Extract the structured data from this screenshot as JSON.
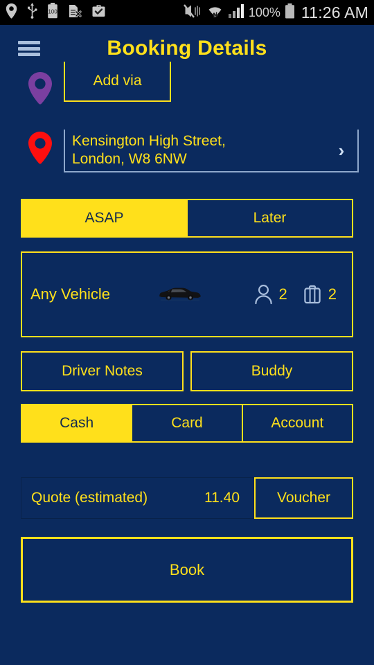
{
  "statusbar": {
    "icons_left": [
      "location-pin-icon",
      "usb-icon",
      "battery-100-icon",
      "sdcard-removed-icon",
      "briefcase-check-icon"
    ],
    "icons_right": [
      "mute-vibrate-icon",
      "wifi-transfer-icon",
      "signal-bars-icon"
    ],
    "battery_percent": "100%",
    "clock": "11:26 AM"
  },
  "header": {
    "title": "Booking Details",
    "menu_icon": "hamburger-menu-icon"
  },
  "route": {
    "via_pin_color": "#7b3fa0",
    "via_label": "Add via",
    "dest_pin_color": "#ff0f0f",
    "dest_address": "Kensington High Street,\nLondon, W8 6NW",
    "dest_chevron": "›"
  },
  "timing": {
    "options": [
      {
        "label": "ASAP",
        "selected": true
      },
      {
        "label": "Later",
        "selected": false
      }
    ]
  },
  "vehicle": {
    "name": "Any Vehicle",
    "car_icon": "sedan-car-icon",
    "passenger_icon": "person-icon",
    "passengers": "2",
    "luggage_icon": "suitcase-icon",
    "luggage": "2"
  },
  "extras": {
    "driver_notes_label": "Driver Notes",
    "buddy_label": "Buddy"
  },
  "payment": {
    "options": [
      {
        "label": "Cash",
        "selected": true
      },
      {
        "label": "Card",
        "selected": false
      },
      {
        "label": "Account",
        "selected": false
      }
    ]
  },
  "quote": {
    "label": "Quote (estimated)",
    "value": "11.40",
    "voucher_label": "Voucher"
  },
  "actions": {
    "book_label": "Book"
  },
  "colors": {
    "background": "#0b2a5e",
    "accent": "#ffe01b",
    "accent_text_on_fill": "#132a4f",
    "icon_blue": "#aabfdd"
  }
}
